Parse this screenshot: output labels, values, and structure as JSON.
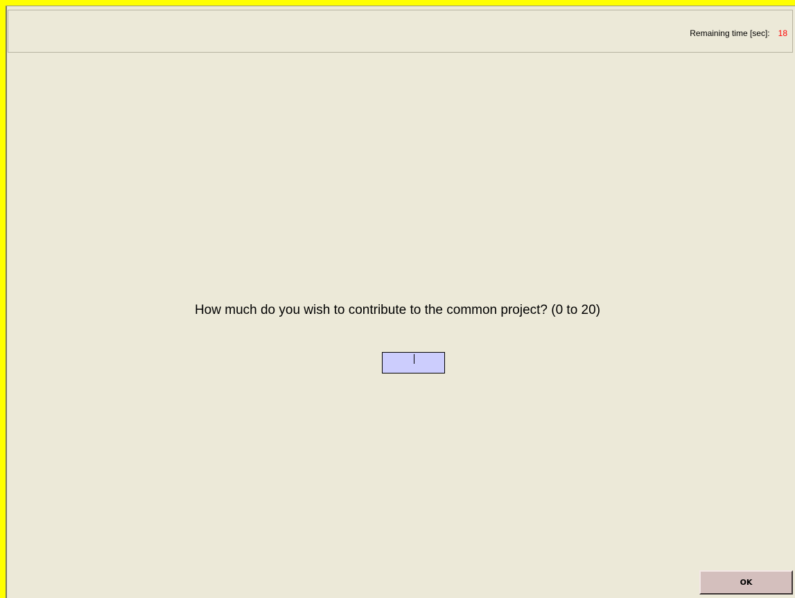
{
  "header": {
    "timer_label": "Remaining time [sec]:",
    "timer_value": "18"
  },
  "main": {
    "question": "How much do you wish to contribute to the common project? (0 to 20)",
    "contribution_value": ""
  },
  "footer": {
    "ok_label": "OK"
  },
  "colors": {
    "frame_accent": "#ffff00",
    "background": "#ece9d8",
    "input_background": "#cccdfd",
    "timer_value": "#ff0000",
    "button_background": "#d4bfbd"
  }
}
